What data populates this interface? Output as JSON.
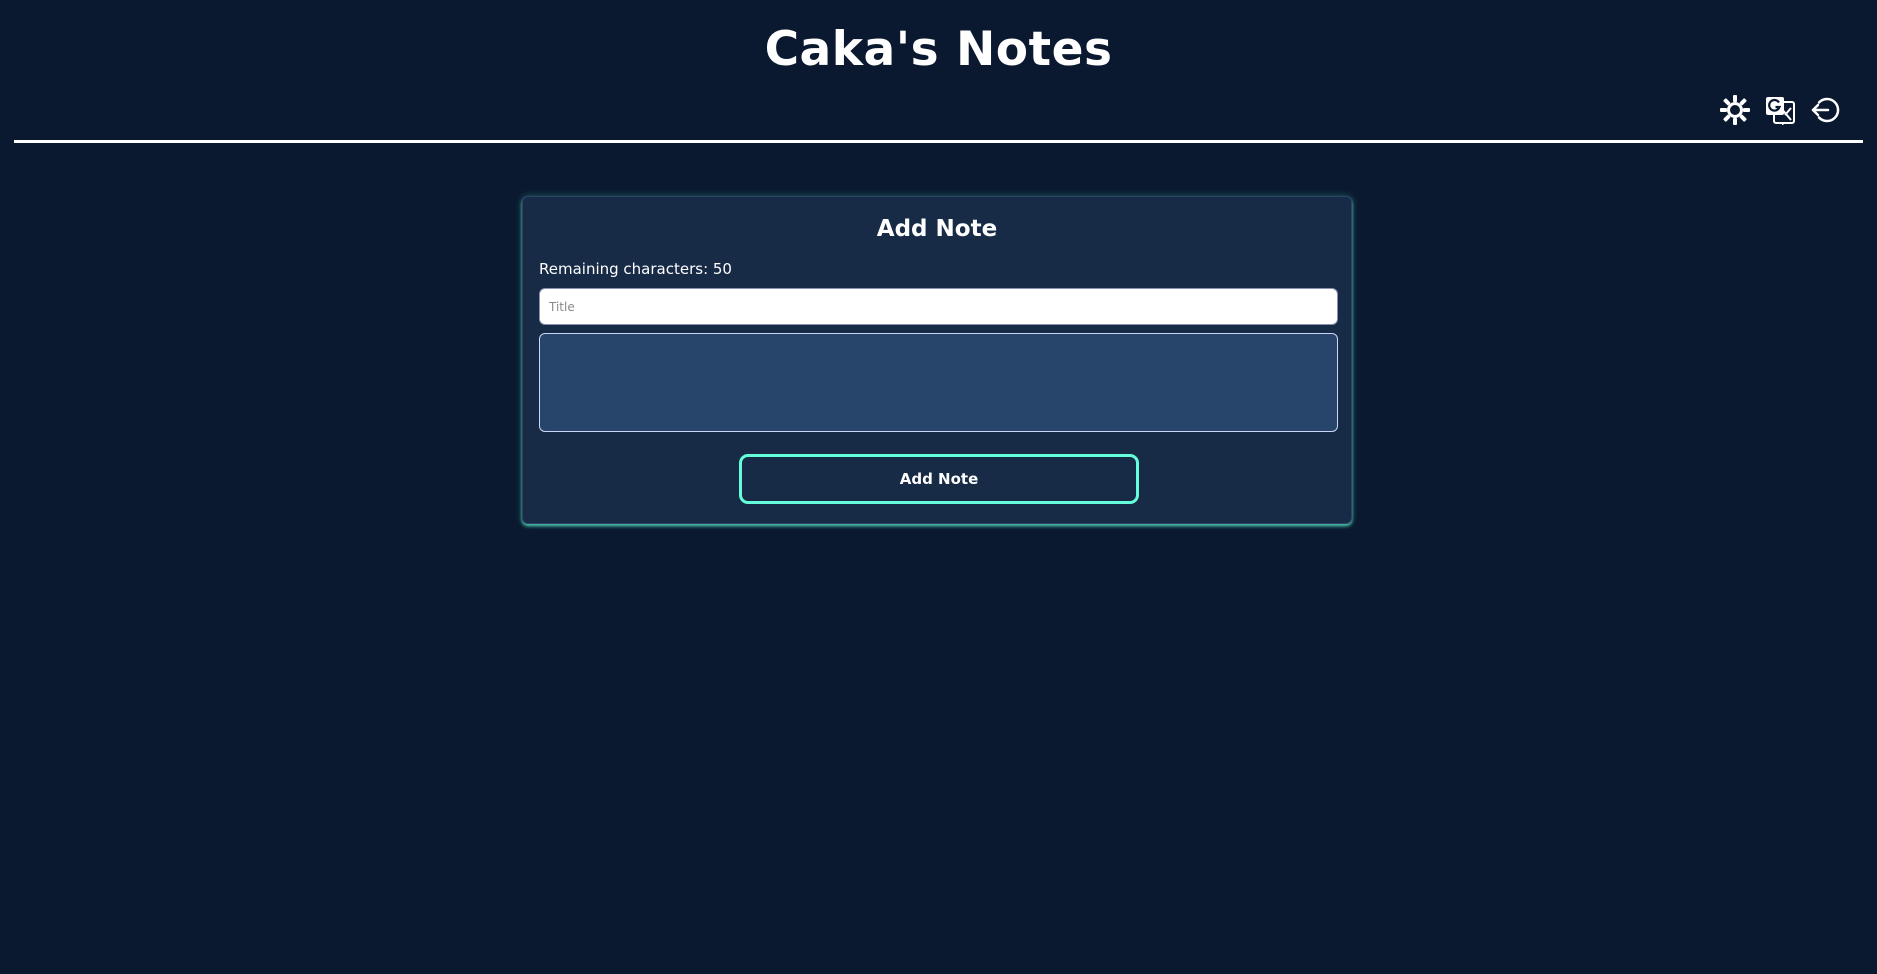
{
  "header": {
    "title": "Caka's Notes",
    "actions": [
      {
        "icon": "sun-icon",
        "label": "Toggle theme"
      },
      {
        "icon": "translate-icon",
        "label": "Change language"
      },
      {
        "icon": "logout-icon",
        "label": "Logout"
      }
    ]
  },
  "note_form": {
    "title": "Add Note",
    "remaining_text": "Remaining characters: 50",
    "title_placeholder": "Title",
    "title_value": "",
    "body_value": "",
    "submit_label": "Add Note"
  },
  "colors": {
    "background": "#0a192f",
    "card": "#172a46",
    "accent": "#64ffda",
    "textarea": "#27446a",
    "text": "#ffffff"
  }
}
